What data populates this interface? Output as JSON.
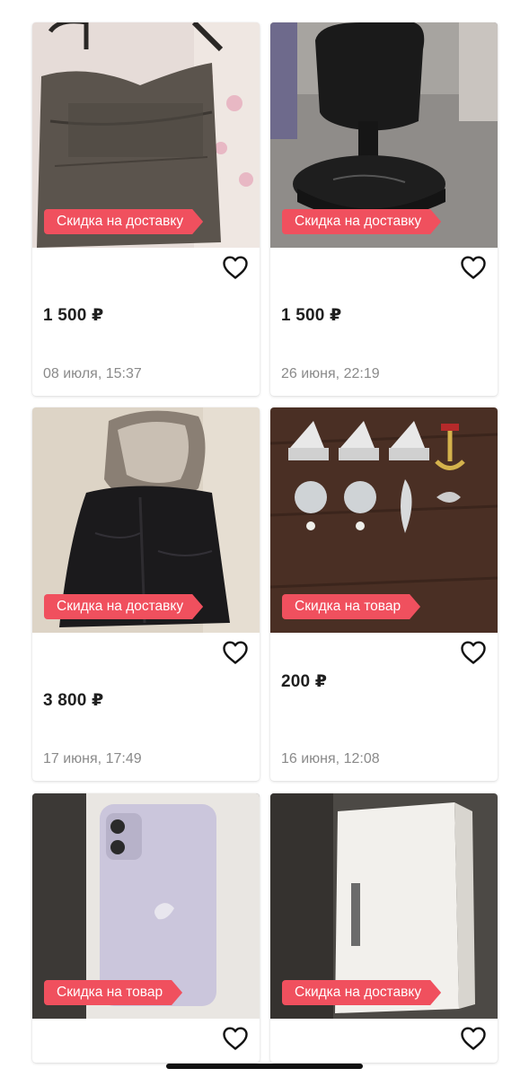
{
  "listings": [
    {
      "promo": "Скидка на доставку",
      "price": "1 500 ₽",
      "date": "08 июля, 15:37"
    },
    {
      "promo": "Скидка на доставку",
      "price": "1 500 ₽",
      "date": "26 июня, 22:19"
    },
    {
      "promo": "Скидка на доставку",
      "price": "3 800 ₽",
      "date": "17 июня, 17:49"
    },
    {
      "promo": "Скидка на товар",
      "price": "200 ₽",
      "date": "16 июня, 12:08"
    },
    {
      "promo": "Скидка на товар"
    },
    {
      "promo": "Скидка на доставку"
    }
  ],
  "icons": {
    "favorite": "heart-outline-icon"
  },
  "colors": {
    "promo_badge": "#f0505e",
    "date_text": "#8a8a8a",
    "price_text": "#1f1f1f"
  }
}
